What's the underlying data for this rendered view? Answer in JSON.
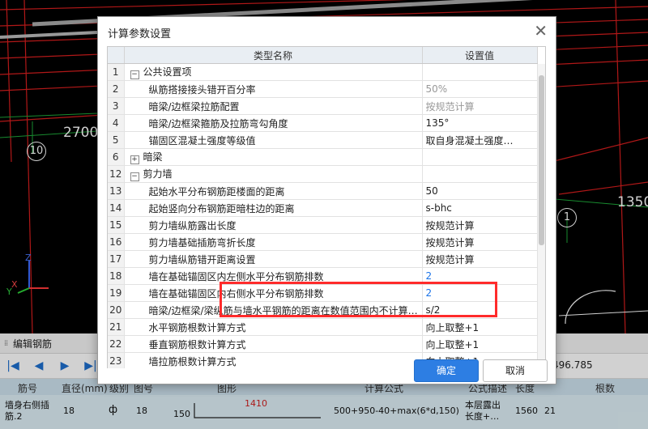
{
  "viewport": {
    "labels": {
      "dim_left": "2700",
      "dim_right": "1350",
      "axis_a": "10",
      "axis_b": "1"
    },
    "gizmo": {
      "z": "Z",
      "x": "X",
      "y": "Y"
    }
  },
  "panel": {
    "title": "编辑钢筋",
    "total_length": "496.785",
    "columns": [
      "筋号",
      "直径(mm)",
      "级别",
      "图号",
      "图形",
      "计算公式",
      "公式描述",
      "长度",
      "根数"
    ],
    "row": {
      "name_line1": "墙身右侧插",
      "name_line2": "筋.2",
      "diameter": "18",
      "grade_icon": "rebar-grade-icon",
      "grade_symbol": "ф",
      "figure_no": "18",
      "shape_left": "150",
      "shape_len": "1410",
      "formula": "500+950-40+max(6*d,150)",
      "desc_line1": "本层露出",
      "desc_line2": "长度+…",
      "length": "1560",
      "count": "21"
    }
  },
  "dialog": {
    "title": "计算参数设置",
    "col_type": "类型名称",
    "col_value": "设置值",
    "ok": "确定",
    "cancel": "取消",
    "rows": [
      {
        "n": "1",
        "kind": "group",
        "toggle": "−",
        "name": "公共设置项",
        "value": ""
      },
      {
        "n": "2",
        "kind": "child",
        "name": "纵筋搭接接头错开百分率",
        "value": "50%",
        "tone": "gray"
      },
      {
        "n": "3",
        "kind": "child",
        "name": "暗梁/边框梁拉筋配置",
        "value": "按规范计算",
        "tone": "gray"
      },
      {
        "n": "4",
        "kind": "child",
        "name": "暗梁/边框梁箍筋及拉筋弯勾角度",
        "value": "135°"
      },
      {
        "n": "5",
        "kind": "child",
        "name": "锚固区混凝土强度等级值",
        "value": "取自身混凝土强度…"
      },
      {
        "n": "6",
        "kind": "group",
        "toggle": "+",
        "name": "暗梁",
        "value": ""
      },
      {
        "n": "12",
        "kind": "group",
        "toggle": "−",
        "name": "剪力墙",
        "value": ""
      },
      {
        "n": "13",
        "kind": "child",
        "name": "起始水平分布钢筋距楼面的距离",
        "value": "50"
      },
      {
        "n": "14",
        "kind": "child",
        "name": "起始竖向分布钢筋距暗柱边的距离",
        "value": "s-bhc"
      },
      {
        "n": "15",
        "kind": "child",
        "name": "剪力墙纵筋露出长度",
        "value": "按规范计算"
      },
      {
        "n": "16",
        "kind": "child",
        "name": "剪力墙基础插筋弯折长度",
        "value": "按规范计算"
      },
      {
        "n": "17",
        "kind": "child",
        "name": "剪力墙纵筋错开距离设置",
        "value": "按规范计算"
      },
      {
        "n": "18",
        "kind": "child",
        "name": "墙在基础锚固区内左侧水平分布钢筋排数",
        "value": "2",
        "tone": "blue"
      },
      {
        "n": "19",
        "kind": "child",
        "name": "墙在基础锚固区内右侧水平分布钢筋排数",
        "value": "2",
        "tone": "blue"
      },
      {
        "n": "20",
        "kind": "child",
        "name": "暗梁/边框梁/梁纵筋与墙水平钢筋的距离在数值范围内不计算…",
        "value": "s/2"
      },
      {
        "n": "21",
        "kind": "child",
        "name": "水平钢筋根数计算方式",
        "value": "向上取整+1"
      },
      {
        "n": "22",
        "kind": "child",
        "name": "垂直钢筋根数计算方式",
        "value": "向上取整+1"
      },
      {
        "n": "23",
        "kind": "child",
        "name": "墙拉筋根数计算方式",
        "value": "向上取整+1"
      }
    ]
  },
  "colors": {
    "highlight": "#ff2b2b",
    "primary": "#2d7ee3",
    "cad_red": "#e02020"
  }
}
